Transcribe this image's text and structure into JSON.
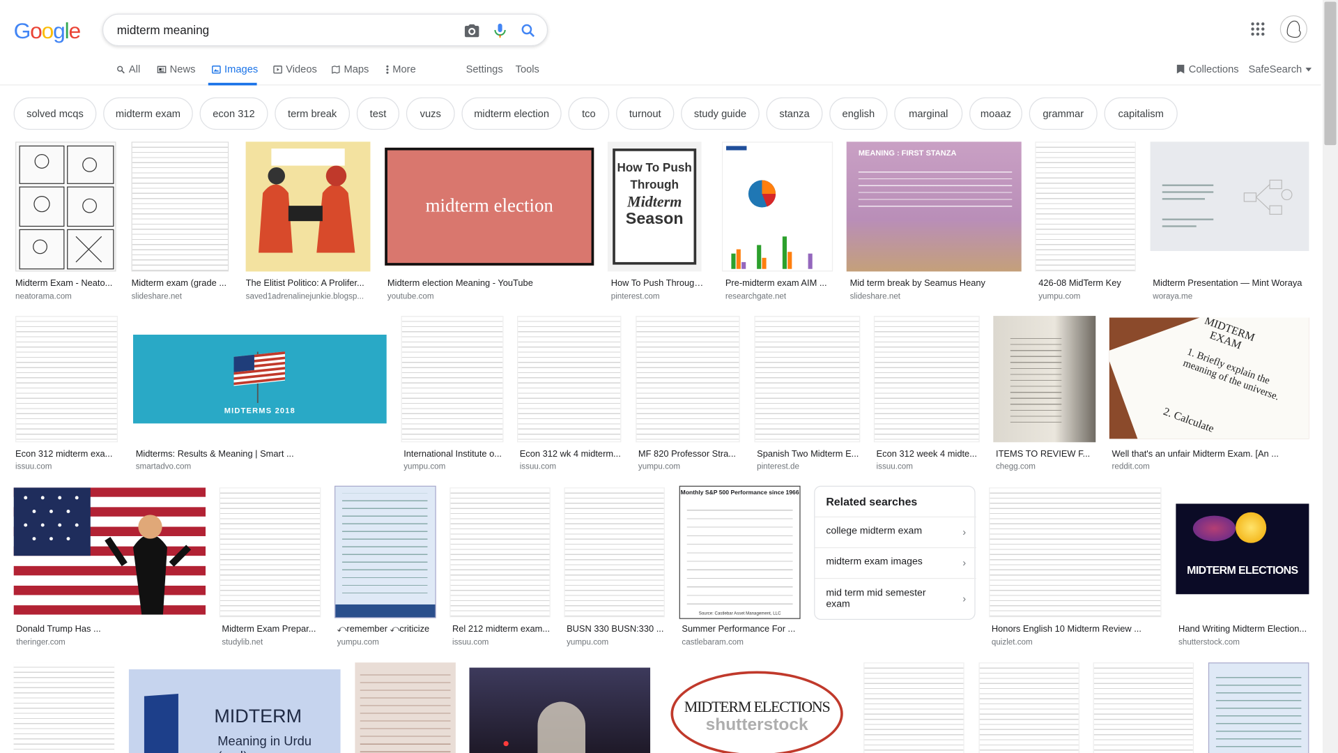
{
  "logo": {
    "text": "Google"
  },
  "search": {
    "query": "midterm meaning"
  },
  "tabs": [
    {
      "label": "All",
      "icon": "search-icon"
    },
    {
      "label": "News",
      "icon": "news-icon"
    },
    {
      "label": "Images",
      "icon": "image-icon"
    },
    {
      "label": "Videos",
      "icon": "video-icon"
    },
    {
      "label": "Maps",
      "icon": "map-icon"
    },
    {
      "label": "More",
      "icon": "more-vert-icon"
    },
    {
      "label": "Settings"
    },
    {
      "label": "Tools"
    }
  ],
  "right_tools": {
    "collections": "Collections",
    "safesearch": "SafeSearch"
  },
  "chips": [
    "solved mcqs",
    "midterm exam",
    "econ 312",
    "term break",
    "test",
    "vuzs",
    "midterm election",
    "tco",
    "turnout",
    "study guide",
    "stanza",
    "english",
    "marginal",
    "moaaz",
    "grammar",
    "capitalism"
  ],
  "results": [
    {
      "title": "Midterm Exam - Neato...",
      "source": "neatorama.com"
    },
    {
      "title": "Midterm exam (grade ...",
      "source": "slideshare.net"
    },
    {
      "title": "The Elitist Politico: A Prolifer...",
      "source": "saved1adrenalinejunkie.blogsp..."
    },
    {
      "title": "Midterm election Meaning - YouTube",
      "source": "youtube.com"
    },
    {
      "title": "How To Push Through...",
      "source": "pinterest.com"
    },
    {
      "title": "Pre-midterm exam AIM ...",
      "source": "researchgate.net"
    },
    {
      "title": "Mid term break by Seamus Heany",
      "source": "slideshare.net"
    },
    {
      "title": "426-08 MidTerm Key",
      "source": "yumpu.com"
    },
    {
      "title": "Midterm Presentation — Mint Woraya",
      "source": "woraya.me"
    },
    {
      "title": "Econ 312 midterm exa...",
      "source": "issuu.com"
    },
    {
      "title": "Midterms: Results & Meaning | Smart ...",
      "source": "smartadvo.com"
    },
    {
      "title": "International Institute o...",
      "source": "yumpu.com"
    },
    {
      "title": "Econ 312 wk 4 midterm...",
      "source": "issuu.com"
    },
    {
      "title": "MF 820 Professor Stra...",
      "source": "yumpu.com"
    },
    {
      "title": "Spanish Two Midterm E...",
      "source": "pinterest.de"
    },
    {
      "title": "Econ 312 week 4 midte...",
      "source": "issuu.com"
    },
    {
      "title": "ITEMS TO REVIEW F...",
      "source": "chegg.com"
    },
    {
      "title": "Well that's an unfair Midterm Exam. [An ...",
      "source": "reddit.com"
    },
    {
      "title": "Donald Trump Has ...",
      "source": "theringer.com"
    },
    {
      "title": "Midterm Exam Prepar...",
      "source": "studylib.net"
    },
    {
      "title": "⤺remember ⤺criticize",
      "source": "yumpu.com"
    },
    {
      "title": "Rel 212 midterm exam...",
      "source": "issuu.com"
    },
    {
      "title": "BUSN 330 BUSN:330 ...",
      "source": "yumpu.com"
    },
    {
      "title": "Summer Performance For ...",
      "source": "castlebaram.com"
    },
    {
      "title": "Honors English 10 Midterm Review ...",
      "source": "quizlet.com"
    },
    {
      "title": "Hand Writing Midterm Election...",
      "source": "shutterstock.com"
    }
  ],
  "thumb_text": {
    "election": "midterm election",
    "push1": "How To Push",
    "push2": "Through",
    "push3": "Midterm",
    "push4": "Season",
    "stanza_head": "MEANING : FIRST STANZA",
    "midterms2018": "MIDTERMS 2018",
    "exam_paper1": "MIDTERM",
    "exam_paper2": "EXAM",
    "exam_paper3": "1. Briefly explain the",
    "exam_paper4": "meaning of the universe.",
    "exam_paper5": "2. Calculate",
    "sp_title": "Monthly S&P 500 Performance since 1966",
    "sp_source": "Source: Castlebar Asset Management, LLC",
    "midterm_elections": "MIDTERM ELECTIONS",
    "urdu1": "MIDTERM",
    "urdu2": "Meaning in Urdu (اردو)",
    "shutter_elections": "MIDTERM ELECTIONS",
    "shutterstock": "shutterst\u0000ck"
  },
  "related": {
    "title": "Related searches",
    "items": [
      "college midterm exam",
      "midterm exam images",
      "mid term mid semester exam"
    ]
  },
  "colors": {
    "accent": "#1a73e8",
    "chip_border": "#dfe1e5",
    "election_bg": "#d9776e",
    "midterms_bg": "#29a9c6"
  }
}
